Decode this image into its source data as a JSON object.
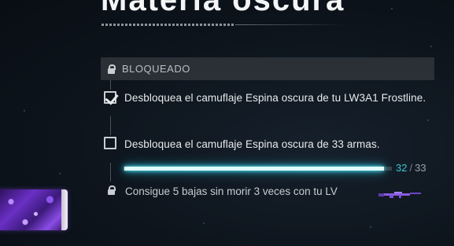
{
  "header": {
    "title": "Materia oscura"
  },
  "status": {
    "label": "BLOQUEADO",
    "icon": "lock-icon"
  },
  "tasks": [
    {
      "text": "Desbloquea el camuflaje Espina oscura de tu LW3A1 Frostline.",
      "completed": true
    },
    {
      "text": "Desbloquea el camuflaje Espina oscura de 33 armas.",
      "completed": false,
      "progress": {
        "current": "32",
        "separator": "/",
        "total": "33",
        "fraction": 0.97
      }
    }
  ],
  "locked_task": {
    "text": "Consigue 5 bajas sin morir 3 veces con tu LV",
    "icon": "lock-icon"
  },
  "colors": {
    "accent": "#3ec4d6",
    "status_bar": "#2b3036",
    "background": "#0d141c",
    "camo": "#6a2fc4"
  }
}
